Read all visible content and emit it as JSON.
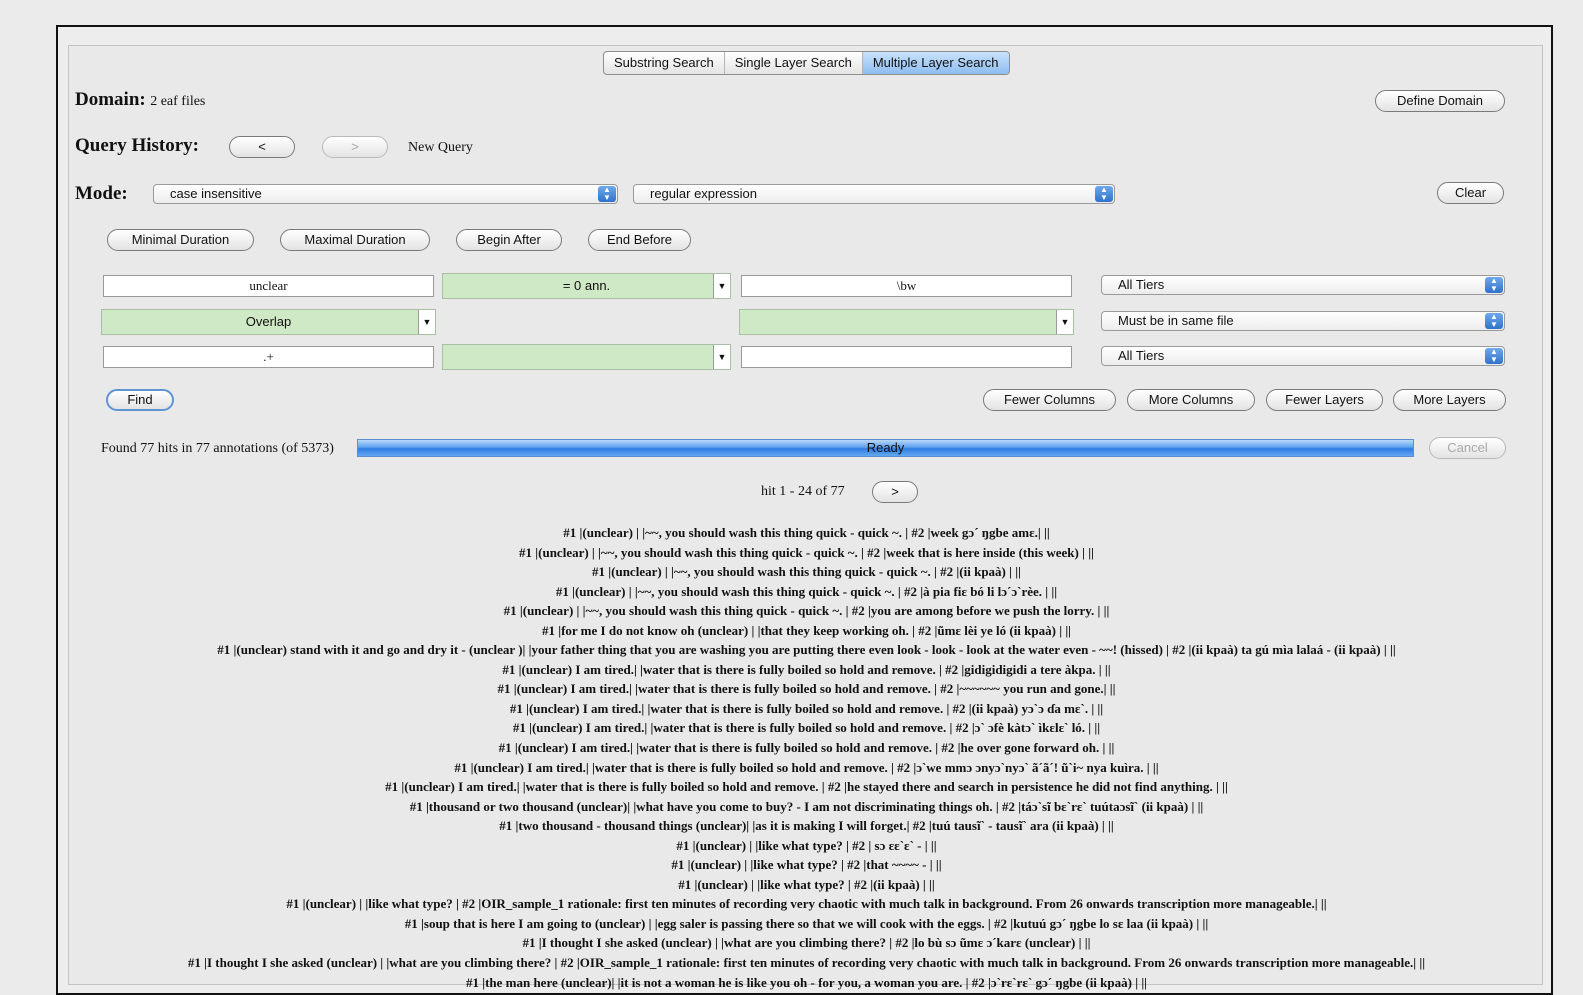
{
  "tabs": [
    {
      "label": "Substring Search",
      "active": false
    },
    {
      "label": "Single Layer Search",
      "active": false
    },
    {
      "label": "Multiple Layer Search",
      "active": true
    }
  ],
  "domain": {
    "label": "Domain:",
    "value": "2 eaf files",
    "define_button": "Define Domain"
  },
  "history": {
    "label": "Query History:",
    "back": "<",
    "forward": ">",
    "new_query": "New Query"
  },
  "mode": {
    "label": "Mode:",
    "case_select": "case insensitive",
    "type_select": "regular expression",
    "clear_button": "Clear"
  },
  "constraints": {
    "min_duration": "Minimal Duration",
    "max_duration": "Maximal Duration",
    "begin_after": "Begin After",
    "end_before": "End Before"
  },
  "grid": {
    "row1": {
      "pattern1": "unclear",
      "relation1": "= 0 ann.",
      "pattern2": "\\bw",
      "tier": "All Tiers"
    },
    "row2": {
      "relation_col1": "Overlap",
      "relation_col2": "",
      "scope": "Must be in same file"
    },
    "row3": {
      "pattern1": ".+",
      "relation1": "",
      "pattern2": "",
      "tier": "All Tiers"
    }
  },
  "actions": {
    "find": "Find",
    "fewer_columns": "Fewer Columns",
    "more_columns": "More Columns",
    "fewer_layers": "Fewer Layers",
    "more_layers": "More Layers"
  },
  "status": {
    "found_text": "Found 77 hits in 77 annotations (of 5373)",
    "progress_text": "Ready",
    "progress_fraction": 1.0,
    "cancel": "Cancel"
  },
  "paging": {
    "hit_text": "hit 1 - 24 of 77",
    "next": ">"
  },
  "colors": {
    "accent": "#2f7de3",
    "green_box": "#cfe8c5",
    "tab_active": "#8dbdf0"
  },
  "results": [
    "#1 |(unclear) | |~~, you should wash this thing quick - quick ~. |  #2 |week gɔ´ ŋgbe amɛ.| ||",
    "#1 |(unclear) | |~~, you should wash this thing quick - quick ~. |  #2 |week that is here inside (this week) | ||",
    "#1 |(unclear) | |~~, you should wash this thing quick - quick ~. |  #2 |(ii kpaà) | ||",
    "#1 |(unclear) | |~~, you should wash this thing quick - quick ~. |  #2 |à pia fiɛ bó li lɔ´ɔ`rèe. | ||",
    "#1 |(unclear) | |~~, you should wash this thing quick - quick ~. |  #2 |you are among before we push the lorry. | ||",
    "#1 |for me I do not know oh (unclear) | |that they keep working oh. |  #2 |ũmɛ lèi ye ló (ii kpaà) | ||",
    "#1 |(unclear) stand with it and go and dry it - (unclear )| |your father thing that you are washing you are putting there even look - look - look at the water even - ~~! (hissed) |  #2 |(ii kpaà) ta gú mìa lalaá - (ii kpaà) | ||",
    "#1 |(unclear) I am tired.| |water that is there is fully boiled so hold and remove. |  #2 |gidigidigidi a tere àkpa. | ||",
    "#1 |(unclear) I am tired.| |water that is there is fully boiled so hold and remove. |  #2 |~~~~~~ you run and gone.| ||",
    "#1 |(unclear) I am tired.| |water that is there is fully boiled so hold and remove. |  #2 |(ii kpaà) yɔ`ɔ ɗa mɛ`. | ||",
    "#1 |(unclear) I am tired.| |water that is there is fully boiled so hold and remove. |  #2 |ɔ` ɔfè kàtɔ` ìkɛlɛ` ló. | ||",
    "#1 |(unclear) I am tired.| |water that is there is fully boiled so hold and remove. |  #2 |he over gone forward oh. | ||",
    "#1 |(unclear) I am tired.| |water that is there is fully boiled so hold and remove. |  #2 |ɔ`we mmɔ ɔnyɔ`nyɔ` ã´ã´! ũ`i~ nya kuìra. | ||",
    "#1 |(unclear) I am tired.| |water that is there is fully boiled so hold and remove. |  #2 |he stayed there and search in persistence he did not find anything. | ||",
    "#1 |thousand or two thousand (unclear)| |what have you come to buy? - I am not discriminating things oh. |  #2 |táɔ`sĩ bɛ`rɛ` tuútaɔsĩ` (ii kpaà) | ||",
    "#1 |two thousand - thousand things (unclear)| |as it is making I will forget.|  #2 |tuú tausĩ` - tausĩ` ara (ii kpaà) | ||",
    "#1 |(unclear) | |like what type? |  #2 | sɔ ɛɛ`ɛ` - | ||",
    "#1 |(unclear) | |like what type? |  #2 |that ~~~~ - | ||",
    "#1 |(unclear) | |like what type? |  #2 |(ii kpaà) | ||",
    "#1 |(unclear) | |like what type? |  #2 |OIR_sample_1 rationale: first ten minutes of recording very chaotic with much talk in background. From 26 onwards transcription more manageable.| ||",
    "#1 |soup that is here I am going to (unclear) | |egg saler is passing there so that we will cook with the eggs. |  #2 |kutuú gɔ´ ŋgbe lo sɛ laa (ii kpaà) | ||",
    "#1 |I thought I she asked (unclear) | |what are you climbing there? |  #2 |lo bù sɔ ũmɛ ɔ´karɛ (unclear) | ||",
    "#1 |I thought I she asked (unclear) | |what are you climbing there? |  #2 |OIR_sample_1 rationale: first ten minutes of recording very chaotic with much talk in background. From 26 onwards transcription more manageable.| ||",
    "#1 |the man here (unclear)| |it is not a woman he is like you oh - for you, a woman you are. |  #2 |ɔ`rɛ`rɛ` gɔ´ ŋgbe (ii kpaà) | ||"
  ]
}
